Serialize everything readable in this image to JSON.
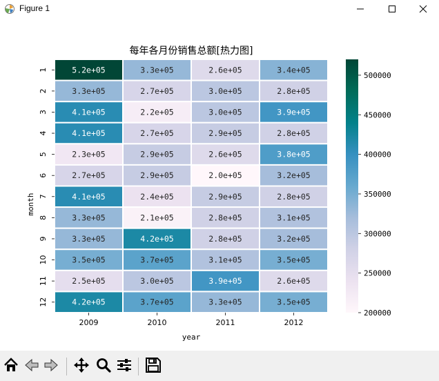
{
  "window": {
    "title": "Figure 1",
    "icon": "matplotlib-icon"
  },
  "window_controls": [
    "minimize-icon",
    "maximize-icon",
    "close-icon"
  ],
  "toolbar": {
    "buttons": [
      {
        "name": "home-button",
        "icon": "home-icon"
      },
      {
        "name": "back-button",
        "icon": "back-arrow-icon"
      },
      {
        "name": "forward-button",
        "icon": "forward-arrow-icon"
      },
      {
        "name": "pan-button",
        "icon": "pan-move-icon"
      },
      {
        "name": "zoom-button",
        "icon": "zoom-magnifier-icon"
      },
      {
        "name": "configure-subplots-button",
        "icon": "sliders-icon"
      },
      {
        "name": "save-button",
        "icon": "save-disk-icon"
      }
    ]
  },
  "chart_data": {
    "type": "heatmap",
    "title": "每年各月份销售总额[热力图]",
    "xlabel": "year",
    "ylabel": "month",
    "x": [
      "2009",
      "2010",
      "2011",
      "2012"
    ],
    "y": [
      "1",
      "2",
      "3",
      "4",
      "5",
      "6",
      "7",
      "8",
      "9",
      "10",
      "11",
      "12"
    ],
    "values": [
      [
        520000,
        330000,
        260000,
        340000
      ],
      [
        330000,
        270000,
        300000,
        280000
      ],
      [
        410000,
        220000,
        300000,
        390000
      ],
      [
        410000,
        270000,
        290000,
        280000
      ],
      [
        230000,
        290000,
        260000,
        380000
      ],
      [
        270000,
        290000,
        200000,
        320000
      ],
      [
        410000,
        240000,
        290000,
        280000
      ],
      [
        330000,
        210000,
        280000,
        310000
      ],
      [
        330000,
        420000,
        280000,
        320000
      ],
      [
        350000,
        370000,
        310000,
        350000
      ],
      [
        250000,
        300000,
        390000,
        260000
      ],
      [
        420000,
        370000,
        330000,
        350000
      ]
    ],
    "annotations": [
      [
        "5.2e+05",
        "3.3e+05",
        "2.6e+05",
        "3.4e+05"
      ],
      [
        "3.3e+05",
        "2.7e+05",
        "3.0e+05",
        "2.8e+05"
      ],
      [
        "4.1e+05",
        "2.2e+05",
        "3.0e+05",
        "3.9e+05"
      ],
      [
        "4.1e+05",
        "2.7e+05",
        "2.9e+05",
        "2.8e+05"
      ],
      [
        "2.3e+05",
        "2.9e+05",
        "2.6e+05",
        "3.8e+05"
      ],
      [
        "2.7e+05",
        "2.9e+05",
        "2.0e+05",
        "3.2e+05"
      ],
      [
        "4.1e+05",
        "2.4e+05",
        "2.9e+05",
        "2.8e+05"
      ],
      [
        "3.3e+05",
        "2.1e+05",
        "2.8e+05",
        "3.1e+05"
      ],
      [
        "3.3e+05",
        "4.2e+05",
        "2.8e+05",
        "3.2e+05"
      ],
      [
        "3.5e+05",
        "3.7e+05",
        "3.1e+05",
        "3.5e+05"
      ],
      [
        "2.5e+05",
        "3.0e+05",
        "3.9e+05",
        "2.6e+05"
      ],
      [
        "4.2e+05",
        "3.7e+05",
        "3.3e+05",
        "3.5e+05"
      ]
    ],
    "colorbar": {
      "range": [
        200000,
        520000
      ],
      "ticks": [
        "200000",
        "250000",
        "300000",
        "350000",
        "400000",
        "450000",
        "500000"
      ],
      "tick_values": [
        200000,
        250000,
        300000,
        350000,
        400000,
        450000,
        500000
      ]
    },
    "colormap": "PuBuGn",
    "colormap_stops": [
      "#fff7fb",
      "#ece2f0",
      "#d0d1e6",
      "#a6bddb",
      "#67a9cf",
      "#3690c0",
      "#02818a",
      "#016c59",
      "#014636"
    ],
    "cell_border_color": "#ffffff",
    "grid": false
  }
}
